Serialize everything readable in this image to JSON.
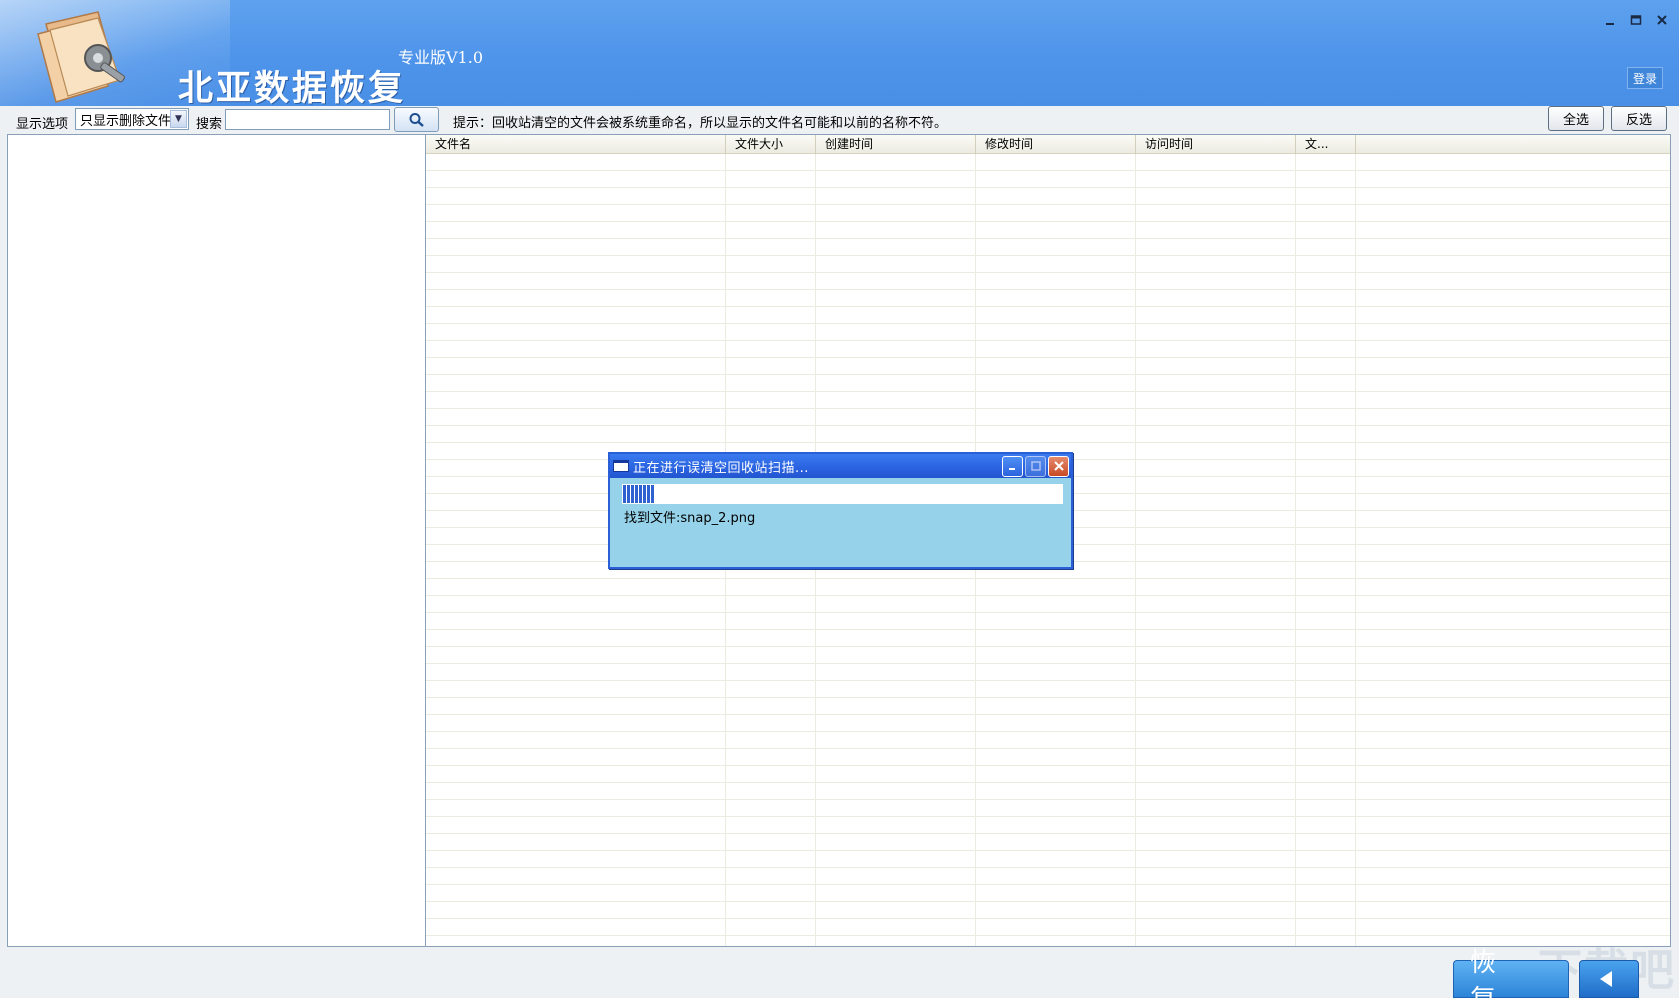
{
  "header": {
    "app_title": "北亚数据恢复",
    "edition": "专业版V1.0",
    "login_label": "登录",
    "window_controls": [
      "minimize-icon",
      "maximize-icon",
      "close-icon"
    ]
  },
  "toolbar": {
    "display_label": "显示选项",
    "display_option": "只显示删除文件",
    "search_label": "搜索",
    "search_value": "",
    "hint": "提示：回收站清空的文件会被系统重命名，所以显示的文件名可能和以前的名称不符。",
    "select_all": "全选",
    "invert_select": "反选"
  },
  "file_list": {
    "columns": [
      "文件名",
      "文件大小",
      "创建时间",
      "修改时间",
      "访问时间",
      "文..."
    ],
    "rows": []
  },
  "dialog": {
    "title": "正在进行误清空回收站扫描...",
    "progress": 0.07,
    "found_text": "找到文件:snap_2.png"
  },
  "footer": {
    "restore_label": "恢 复",
    "watermark": "下载吧"
  },
  "colors": {
    "header_blue": "#4e94ea",
    "dialog_bg": "#96d3ea",
    "titlebar_blue": "#2a62e0"
  }
}
